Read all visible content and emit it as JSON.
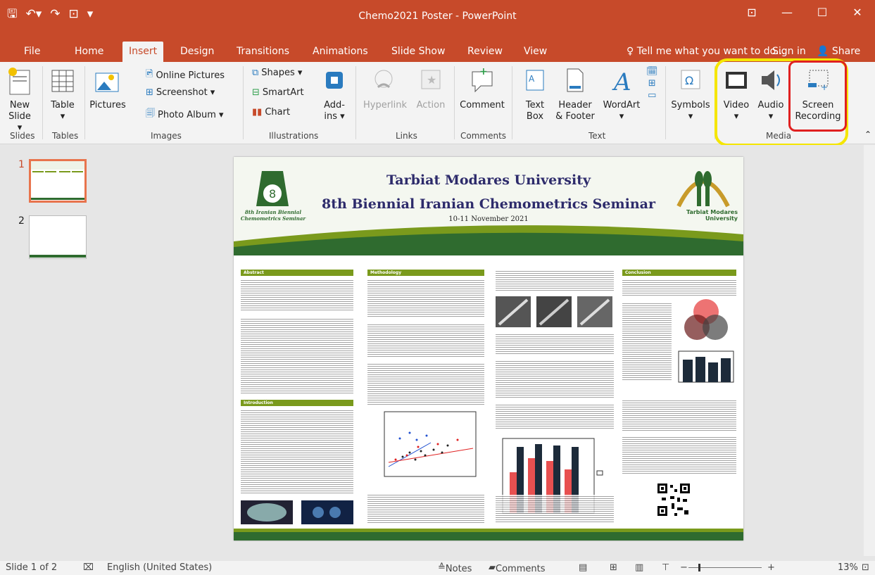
{
  "window": {
    "title": "Chemo2021 Poster - PowerPoint",
    "controls": [
      "⊡",
      "—",
      "☐",
      "✕"
    ]
  },
  "tabs": [
    "File",
    "Home",
    "Insert",
    "Design",
    "Transitions",
    "Animations",
    "Slide Show",
    "Review",
    "View"
  ],
  "active_tab": "Insert",
  "tell_me": "Tell me what you want to do...",
  "sign_in": "Sign in",
  "share": "Share",
  "ribbon": {
    "new_slide": [
      "New",
      "Slide ▾"
    ],
    "table": "Table",
    "pictures": "Pictures",
    "online_pictures": "Online Pictures",
    "screenshot": "Screenshot ▾",
    "photo_album": "Photo Album ▾",
    "shapes": "Shapes ▾",
    "smartart": "SmartArt",
    "chart": "Chart",
    "addins": [
      "Add-",
      "ins ▾"
    ],
    "hyperlink": "Hyperlink",
    "action": "Action",
    "comment": "Comment",
    "textbox": [
      "Text",
      "Box"
    ],
    "header_footer": [
      "Header",
      "& Footer"
    ],
    "wordart": "WordArt",
    "symbols": "Symbols",
    "video": "Video",
    "audio": "Audio",
    "screen_recording": [
      "Screen",
      "Recording"
    ],
    "groups": [
      "Slides",
      "Tables",
      "Images",
      "Illustrations",
      "Links",
      "Comments",
      "Text",
      "Media"
    ]
  },
  "thumbnails": [
    "1",
    "2"
  ],
  "poster": {
    "title1": "Tarbiat Modares University",
    "title2": "8th Biennial Iranian Chemometrics Seminar",
    "date": "10-11 November 2021",
    "logo_left": [
      "8th Iranian Biennial",
      "Chemometrics Seminar"
    ],
    "logo_right": [
      "Tarbiat Modares",
      "University"
    ],
    "sections": [
      "Abstract",
      "Methodology",
      "Conclusion",
      "Introduction"
    ]
  },
  "status": {
    "slide": "Slide 1 of 2",
    "language": "English (United States)",
    "notes": "Notes",
    "comments": "Comments",
    "zoom": "13%"
  },
  "colors": {
    "accent": "#c74a2a",
    "poster_green": "#7a9a1c",
    "poster_title": "#2d2b6b",
    "highlight_yellow": "#f5e600",
    "highlight_red": "#e02020"
  }
}
